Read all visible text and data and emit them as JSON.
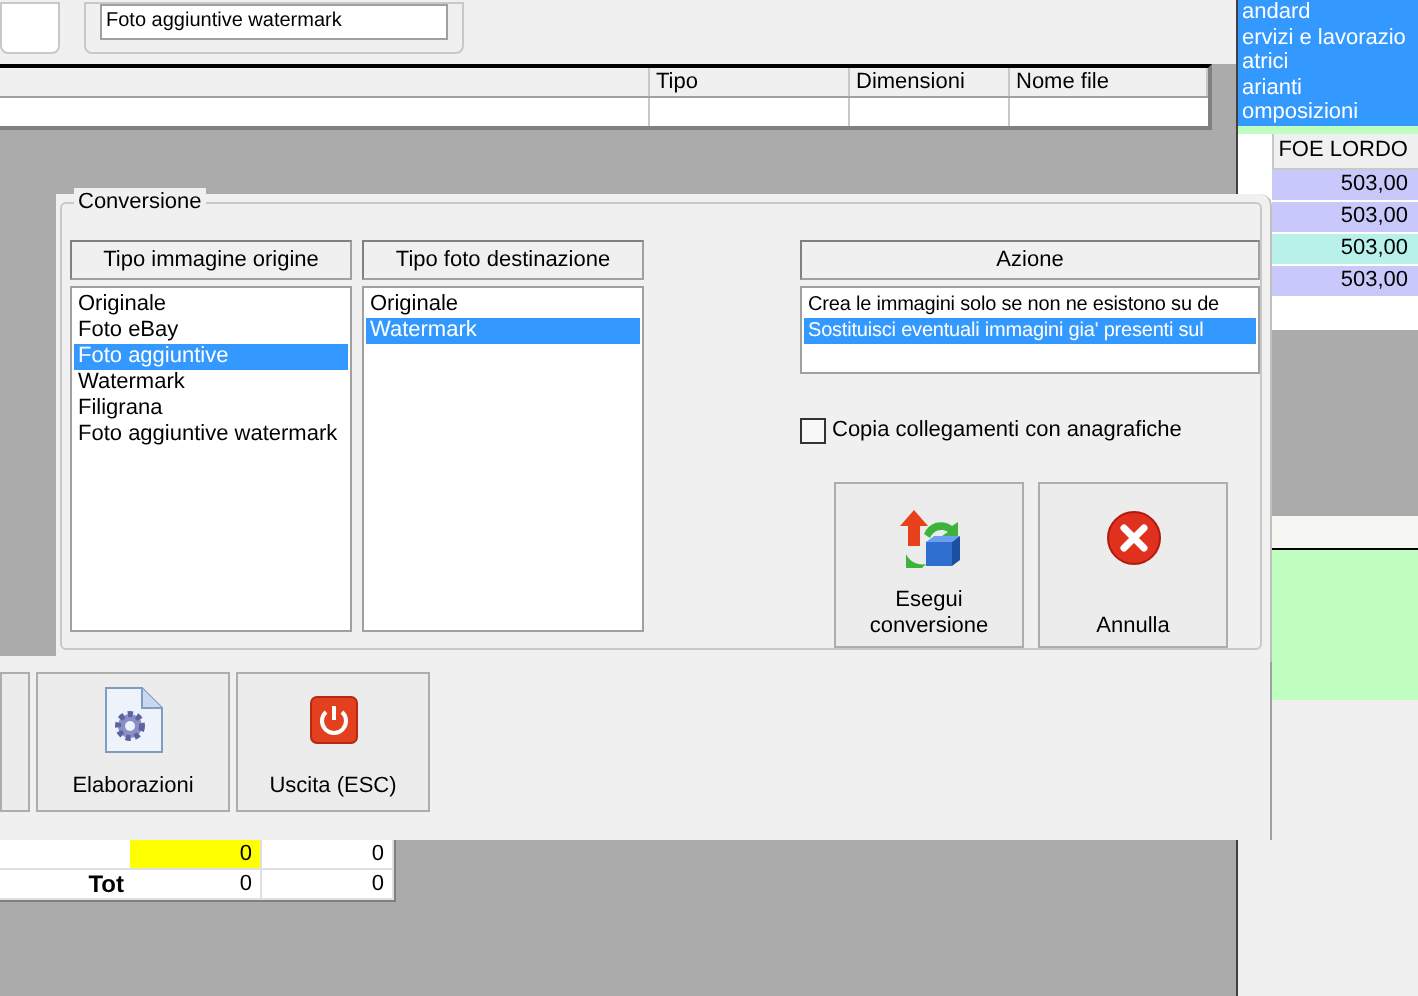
{
  "top_panel": {
    "list_item": "Foto aggiuntive watermark"
  },
  "images_table": {
    "columns": [
      "Tipo",
      "Dimensioni",
      "Nome file"
    ]
  },
  "side_list": {
    "items": [
      {
        "label": "andard",
        "selected": true
      },
      {
        "label": "ervizi e lavorazio",
        "selected": true
      },
      {
        "label": "atrici",
        "selected": true
      },
      {
        "label": "arianti",
        "selected": true
      },
      {
        "label": "omposizioni",
        "selected": true
      }
    ]
  },
  "prices_table": {
    "column": "FOE LORDO",
    "rows": [
      {
        "value": "503,00",
        "color": "#c8c8fa"
      },
      {
        "value": "503,00",
        "color": "#c8c8fa"
      },
      {
        "value": "503,00",
        "color": "#b8f0ea"
      },
      {
        "value": "503,00",
        "color": "#c8c8fa"
      }
    ]
  },
  "totals_table": {
    "rows": [
      {
        "cells": [
          {
            "text": "0",
            "highlight": true
          },
          {
            "text": "0",
            "highlight": false
          }
        ]
      },
      {
        "label": "Tot",
        "cells": [
          {
            "text": "0",
            "highlight": false
          },
          {
            "text": "0",
            "highlight": false
          }
        ]
      }
    ]
  },
  "toolbar": {
    "buttons": [
      {
        "kind": "process",
        "label": "Elaborazioni"
      },
      {
        "kind": "exit",
        "label": "Uscita (ESC)"
      }
    ]
  },
  "dialog": {
    "group_title": "Conversione",
    "origin_list": {
      "header": "Tipo immagine origine",
      "items": [
        {
          "label": "Originale",
          "selected": false
        },
        {
          "label": "Foto eBay",
          "selected": false
        },
        {
          "label": "Foto aggiuntive",
          "selected": true
        },
        {
          "label": "Watermark",
          "selected": false
        },
        {
          "label": "Filigrana",
          "selected": false
        },
        {
          "label": "Foto aggiuntive watermark",
          "selected": false
        }
      ]
    },
    "destination_list": {
      "header": "Tipo foto destinazione",
      "items": [
        {
          "label": "Originale",
          "selected": false
        },
        {
          "label": "Watermark",
          "selected": true
        }
      ]
    },
    "action_list": {
      "header": "Azione",
      "items": [
        {
          "label": "Crea le immagini solo se non ne esistono su de",
          "selected": false
        },
        {
          "label": "Sostituisci eventuali immagini gia' presenti sul",
          "selected": true
        }
      ]
    },
    "copy_links": {
      "label": "Copia collegamenti con anagrafiche",
      "checked": false
    },
    "buttons": [
      {
        "kind": "convert",
        "label": "Esegui conversione"
      },
      {
        "kind": "cancel",
        "label": "Annulla"
      }
    ]
  }
}
